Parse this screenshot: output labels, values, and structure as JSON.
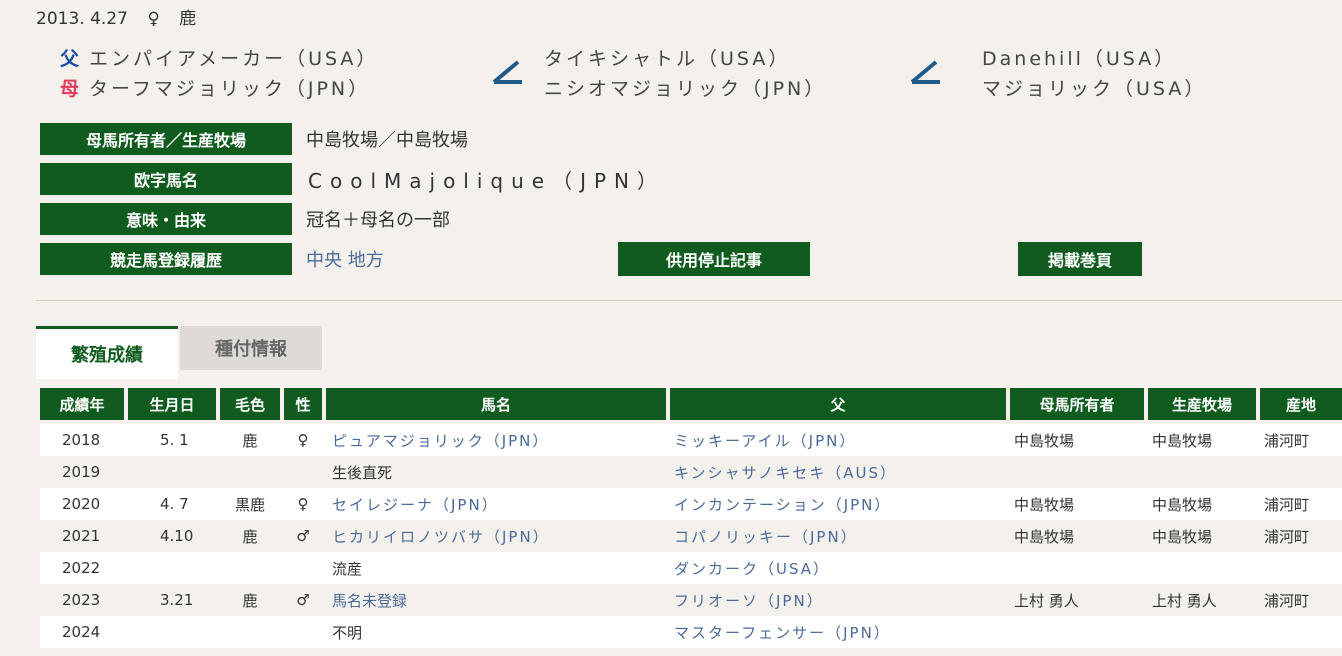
{
  "top": {
    "date": "2013. 4.27",
    "sex_symbol": "♀",
    "color": "鹿"
  },
  "pedigree": {
    "father_symbol": "父",
    "mother_symbol": "母",
    "father": "エンパイアメーカー（USA）",
    "mother": "ターフマジョリック（JPN）",
    "sire_sire": "タイキシャトル（USA）",
    "dam_sire": "ニシオマジョリック（JPN）",
    "gen3_top": "Danehill（USA）",
    "gen3_bottom": "マジョリック（USA）"
  },
  "info": {
    "owner_label": "母馬所有者／生産牧場",
    "owner_value": "中島牧場／中島牧場",
    "roman_label": "欧字馬名",
    "roman_value": "CoolMajolique（JPN）",
    "meaning_label": "意味・由来",
    "meaning_value": "冠名＋母名の一部",
    "history_label": "競走馬登録履歴",
    "history_central": "中央",
    "history_local": "地方",
    "stop_button": "供用停止記事",
    "volume_button": "掲載巻頁"
  },
  "tabs": {
    "active": "繁殖成績",
    "inactive": "種付情報"
  },
  "table": {
    "headers": [
      "成績年",
      "生月日",
      "毛色",
      "性",
      "馬名",
      "父",
      "母馬所有者",
      "生産牧場",
      "産地"
    ],
    "rows": [
      [
        "2018",
        "5. 1",
        "鹿",
        "♀",
        "ピュアマジョリック（JPN）",
        "ミッキーアイル（JPN）",
        "中島牧場",
        "中島牧場",
        "浦河町"
      ],
      [
        "2019",
        "",
        "",
        "",
        "生後直死",
        "キンシャサノキセキ（AUS）",
        "",
        "",
        ""
      ],
      [
        "2020",
        "4. 7",
        "黒鹿",
        "♀",
        "セイレジーナ（JPN）",
        "インカンテーション（JPN）",
        "中島牧場",
        "中島牧場",
        "浦河町"
      ],
      [
        "2021",
        "4.10",
        "鹿",
        "♂",
        "ヒカリイロノツバサ（JPN）",
        "コパノリッキー（JPN）",
        "中島牧場",
        "中島牧場",
        "浦河町"
      ],
      [
        "2022",
        "",
        "",
        "",
        "流産",
        "ダンカーク（USA）",
        "",
        "",
        ""
      ],
      [
        "2023",
        "3.21",
        "鹿",
        "♂",
        "馬名未登録",
        "フリオーソ（JPN）",
        "上村 勇人",
        "上村 勇人",
        "浦河町"
      ],
      [
        "2024",
        "",
        "",
        "",
        "不明",
        "マスターフェンサー（JPN）",
        "",
        "",
        ""
      ]
    ]
  }
}
